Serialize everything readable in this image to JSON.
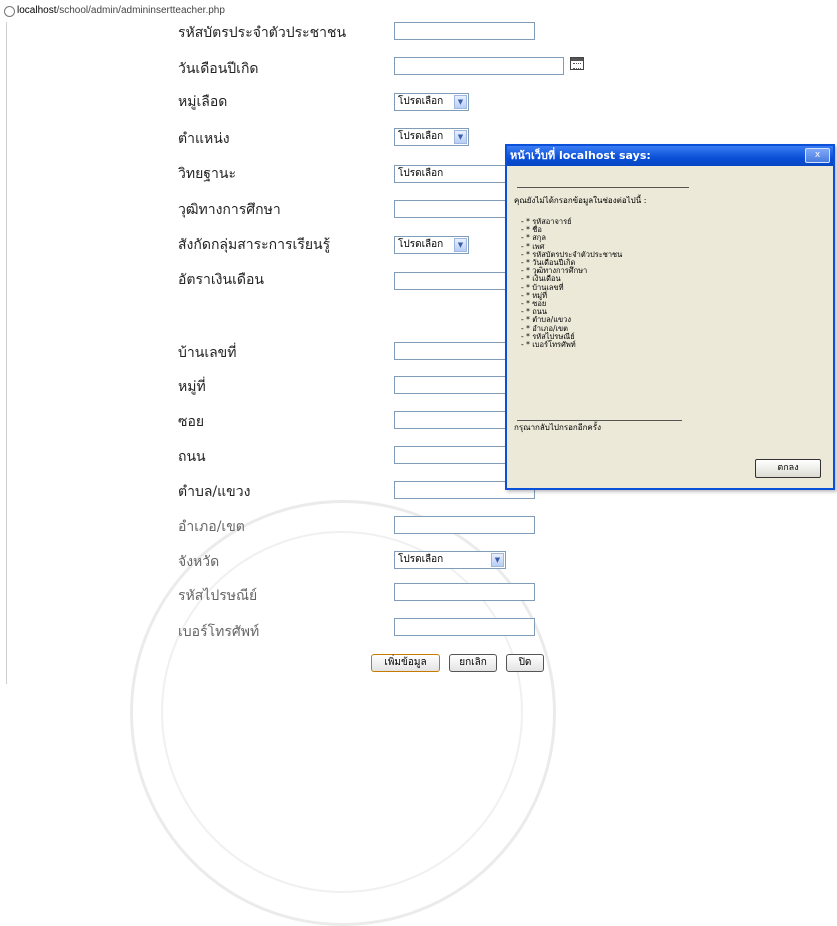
{
  "url": {
    "host": "localhost",
    "path": "/school/admin/admininsertteacher.php"
  },
  "form": {
    "labels": [
      "รหัสบัตรประจำตัวประชาชน",
      "วันเดือนปีเกิด",
      "หมู่เลือด",
      "ตำแหน่ง",
      "วิทยฐานะ",
      "วุฒิทางการศึกษา",
      "สังกัดกลุ่มสาระการเรียนรู้",
      "อัตราเงินเดือน",
      "บ้านเลขที่",
      "หมู่ที่",
      "ซอย",
      "ถนน",
      "ตำบล/แขวง",
      "อำเภอ/เขต",
      "จังหวัด",
      "รหัสไปรษณีย์",
      "เบอร์โทรศัพท์"
    ],
    "select_default": "โปรดเลือก",
    "buttons": {
      "add": "เพิ่มข้อมูล",
      "cancel": "ยกเลิก",
      "close": "ปิด"
    }
  },
  "dialog": {
    "title": "หน้าเว็บที่ localhost says:",
    "close_symbol": "x",
    "message": "คุณยังไม่ได้กรอกข้อมูลในช่องต่อไปนี้ :",
    "items": [
      "- * รหัสอาจารย์",
      "- * ชื่อ",
      "- * สกุล",
      "- * เพศ",
      "- * รหัสบัตรประจำตัวประชาชน",
      "- * วันเดือนปีเกิด",
      "- * วุฒิทางการศึกษา",
      "- * เงินเดือน",
      "- * บ้านเลขที่",
      "- * หมู่ที่",
      "- * ซอย",
      "- * ถนน",
      "- * ตำบล/แขวง",
      "- * อำเภอ/เขต",
      "- * รหัสไปรษณีย์",
      "- * เบอร์โทรศัพท์"
    ],
    "footer": "กรุณากลับไปกรอกอีกครั้ง",
    "ok": "ตกลง"
  }
}
